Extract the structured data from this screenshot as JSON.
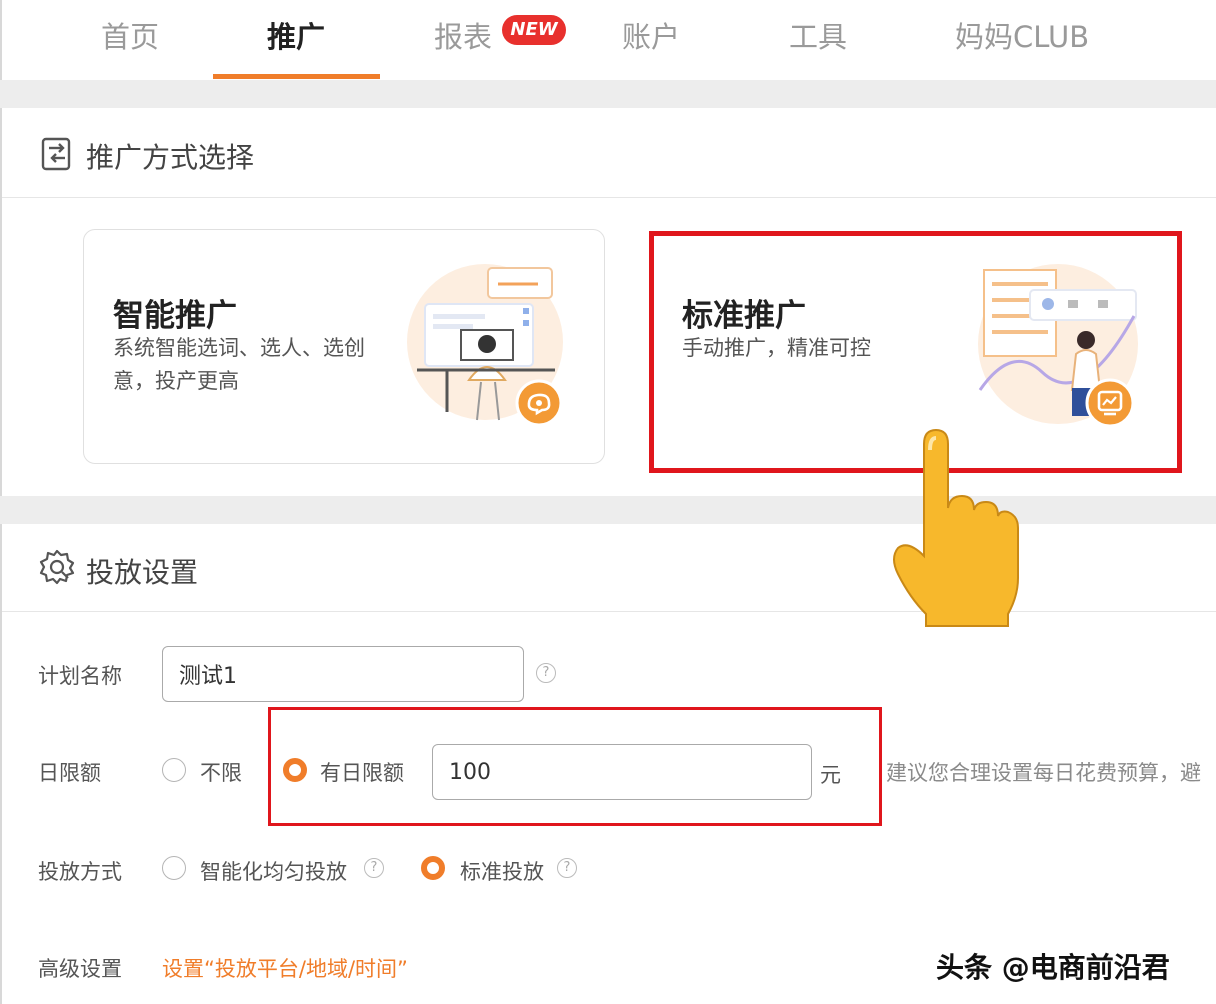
{
  "nav": {
    "tabs": [
      {
        "label": "首页"
      },
      {
        "label": "推广"
      },
      {
        "label": "报表"
      },
      {
        "label": "账户"
      },
      {
        "label": "工具"
      },
      {
        "label": "妈妈CLUB"
      }
    ],
    "active_index": 1,
    "new_badge": "NEW"
  },
  "method_section": {
    "title": "推广方式选择",
    "options": [
      {
        "title": "智能推广",
        "desc": "系统智能选词、选人、选创意，投产更高"
      },
      {
        "title": "标准推广",
        "desc": "手动推广，精准可控"
      }
    ]
  },
  "delivery_section": {
    "title": "投放设置",
    "plan_name": {
      "label": "计划名称",
      "value": "测试1"
    },
    "daily_limit": {
      "label": "日限额",
      "options": [
        "不限",
        "有日限额"
      ],
      "selected": "有日限额",
      "value": "100",
      "unit": "元",
      "hint": "建议您合理设置每日花费预算，避"
    },
    "delivery_method": {
      "label": "投放方式",
      "options": [
        "智能化均匀投放",
        "标准投放"
      ],
      "selected": "标准投放"
    },
    "advanced": {
      "label": "高级设置",
      "link": "设置“投放平台/地域/时间”"
    }
  },
  "watermark": "头条 @电商前沿君",
  "colors": {
    "accent": "#f07d2a",
    "highlight_frame": "#e0161c",
    "badge": "#e8302d"
  }
}
